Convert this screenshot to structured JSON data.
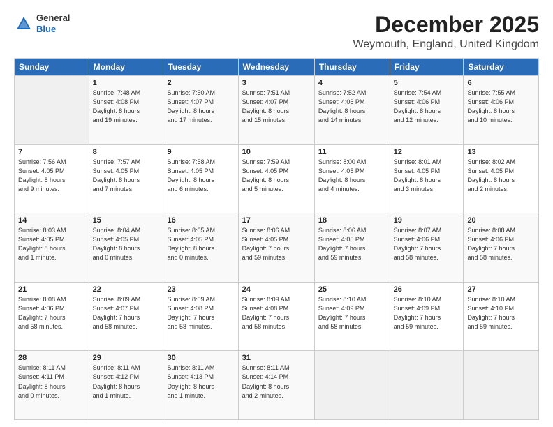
{
  "header": {
    "logo_line1": "General",
    "logo_line2": "Blue",
    "title": "December 2025",
    "subtitle": "Weymouth, England, United Kingdom"
  },
  "columns": [
    "Sunday",
    "Monday",
    "Tuesday",
    "Wednesday",
    "Thursday",
    "Friday",
    "Saturday"
  ],
  "weeks": [
    [
      {
        "day": "",
        "info": ""
      },
      {
        "day": "1",
        "info": "Sunrise: 7:48 AM\nSunset: 4:08 PM\nDaylight: 8 hours\nand 19 minutes."
      },
      {
        "day": "2",
        "info": "Sunrise: 7:50 AM\nSunset: 4:07 PM\nDaylight: 8 hours\nand 17 minutes."
      },
      {
        "day": "3",
        "info": "Sunrise: 7:51 AM\nSunset: 4:07 PM\nDaylight: 8 hours\nand 15 minutes."
      },
      {
        "day": "4",
        "info": "Sunrise: 7:52 AM\nSunset: 4:06 PM\nDaylight: 8 hours\nand 14 minutes."
      },
      {
        "day": "5",
        "info": "Sunrise: 7:54 AM\nSunset: 4:06 PM\nDaylight: 8 hours\nand 12 minutes."
      },
      {
        "day": "6",
        "info": "Sunrise: 7:55 AM\nSunset: 4:06 PM\nDaylight: 8 hours\nand 10 minutes."
      }
    ],
    [
      {
        "day": "7",
        "info": "Sunrise: 7:56 AM\nSunset: 4:05 PM\nDaylight: 8 hours\nand 9 minutes."
      },
      {
        "day": "8",
        "info": "Sunrise: 7:57 AM\nSunset: 4:05 PM\nDaylight: 8 hours\nand 7 minutes."
      },
      {
        "day": "9",
        "info": "Sunrise: 7:58 AM\nSunset: 4:05 PM\nDaylight: 8 hours\nand 6 minutes."
      },
      {
        "day": "10",
        "info": "Sunrise: 7:59 AM\nSunset: 4:05 PM\nDaylight: 8 hours\nand 5 minutes."
      },
      {
        "day": "11",
        "info": "Sunrise: 8:00 AM\nSunset: 4:05 PM\nDaylight: 8 hours\nand 4 minutes."
      },
      {
        "day": "12",
        "info": "Sunrise: 8:01 AM\nSunset: 4:05 PM\nDaylight: 8 hours\nand 3 minutes."
      },
      {
        "day": "13",
        "info": "Sunrise: 8:02 AM\nSunset: 4:05 PM\nDaylight: 8 hours\nand 2 minutes."
      }
    ],
    [
      {
        "day": "14",
        "info": "Sunrise: 8:03 AM\nSunset: 4:05 PM\nDaylight: 8 hours\nand 1 minute."
      },
      {
        "day": "15",
        "info": "Sunrise: 8:04 AM\nSunset: 4:05 PM\nDaylight: 8 hours\nand 0 minutes."
      },
      {
        "day": "16",
        "info": "Sunrise: 8:05 AM\nSunset: 4:05 PM\nDaylight: 8 hours\nand 0 minutes."
      },
      {
        "day": "17",
        "info": "Sunrise: 8:06 AM\nSunset: 4:05 PM\nDaylight: 7 hours\nand 59 minutes."
      },
      {
        "day": "18",
        "info": "Sunrise: 8:06 AM\nSunset: 4:05 PM\nDaylight: 7 hours\nand 59 minutes."
      },
      {
        "day": "19",
        "info": "Sunrise: 8:07 AM\nSunset: 4:06 PM\nDaylight: 7 hours\nand 58 minutes."
      },
      {
        "day": "20",
        "info": "Sunrise: 8:08 AM\nSunset: 4:06 PM\nDaylight: 7 hours\nand 58 minutes."
      }
    ],
    [
      {
        "day": "21",
        "info": "Sunrise: 8:08 AM\nSunset: 4:06 PM\nDaylight: 7 hours\nand 58 minutes."
      },
      {
        "day": "22",
        "info": "Sunrise: 8:09 AM\nSunset: 4:07 PM\nDaylight: 7 hours\nand 58 minutes."
      },
      {
        "day": "23",
        "info": "Sunrise: 8:09 AM\nSunset: 4:08 PM\nDaylight: 7 hours\nand 58 minutes."
      },
      {
        "day": "24",
        "info": "Sunrise: 8:09 AM\nSunset: 4:08 PM\nDaylight: 7 hours\nand 58 minutes."
      },
      {
        "day": "25",
        "info": "Sunrise: 8:10 AM\nSunset: 4:09 PM\nDaylight: 7 hours\nand 58 minutes."
      },
      {
        "day": "26",
        "info": "Sunrise: 8:10 AM\nSunset: 4:09 PM\nDaylight: 7 hours\nand 59 minutes."
      },
      {
        "day": "27",
        "info": "Sunrise: 8:10 AM\nSunset: 4:10 PM\nDaylight: 7 hours\nand 59 minutes."
      }
    ],
    [
      {
        "day": "28",
        "info": "Sunrise: 8:11 AM\nSunset: 4:11 PM\nDaylight: 8 hours\nand 0 minutes."
      },
      {
        "day": "29",
        "info": "Sunrise: 8:11 AM\nSunset: 4:12 PM\nDaylight: 8 hours\nand 1 minute."
      },
      {
        "day": "30",
        "info": "Sunrise: 8:11 AM\nSunset: 4:13 PM\nDaylight: 8 hours\nand 1 minute."
      },
      {
        "day": "31",
        "info": "Sunrise: 8:11 AM\nSunset: 4:14 PM\nDaylight: 8 hours\nand 2 minutes."
      },
      {
        "day": "",
        "info": ""
      },
      {
        "day": "",
        "info": ""
      },
      {
        "day": "",
        "info": ""
      }
    ]
  ]
}
